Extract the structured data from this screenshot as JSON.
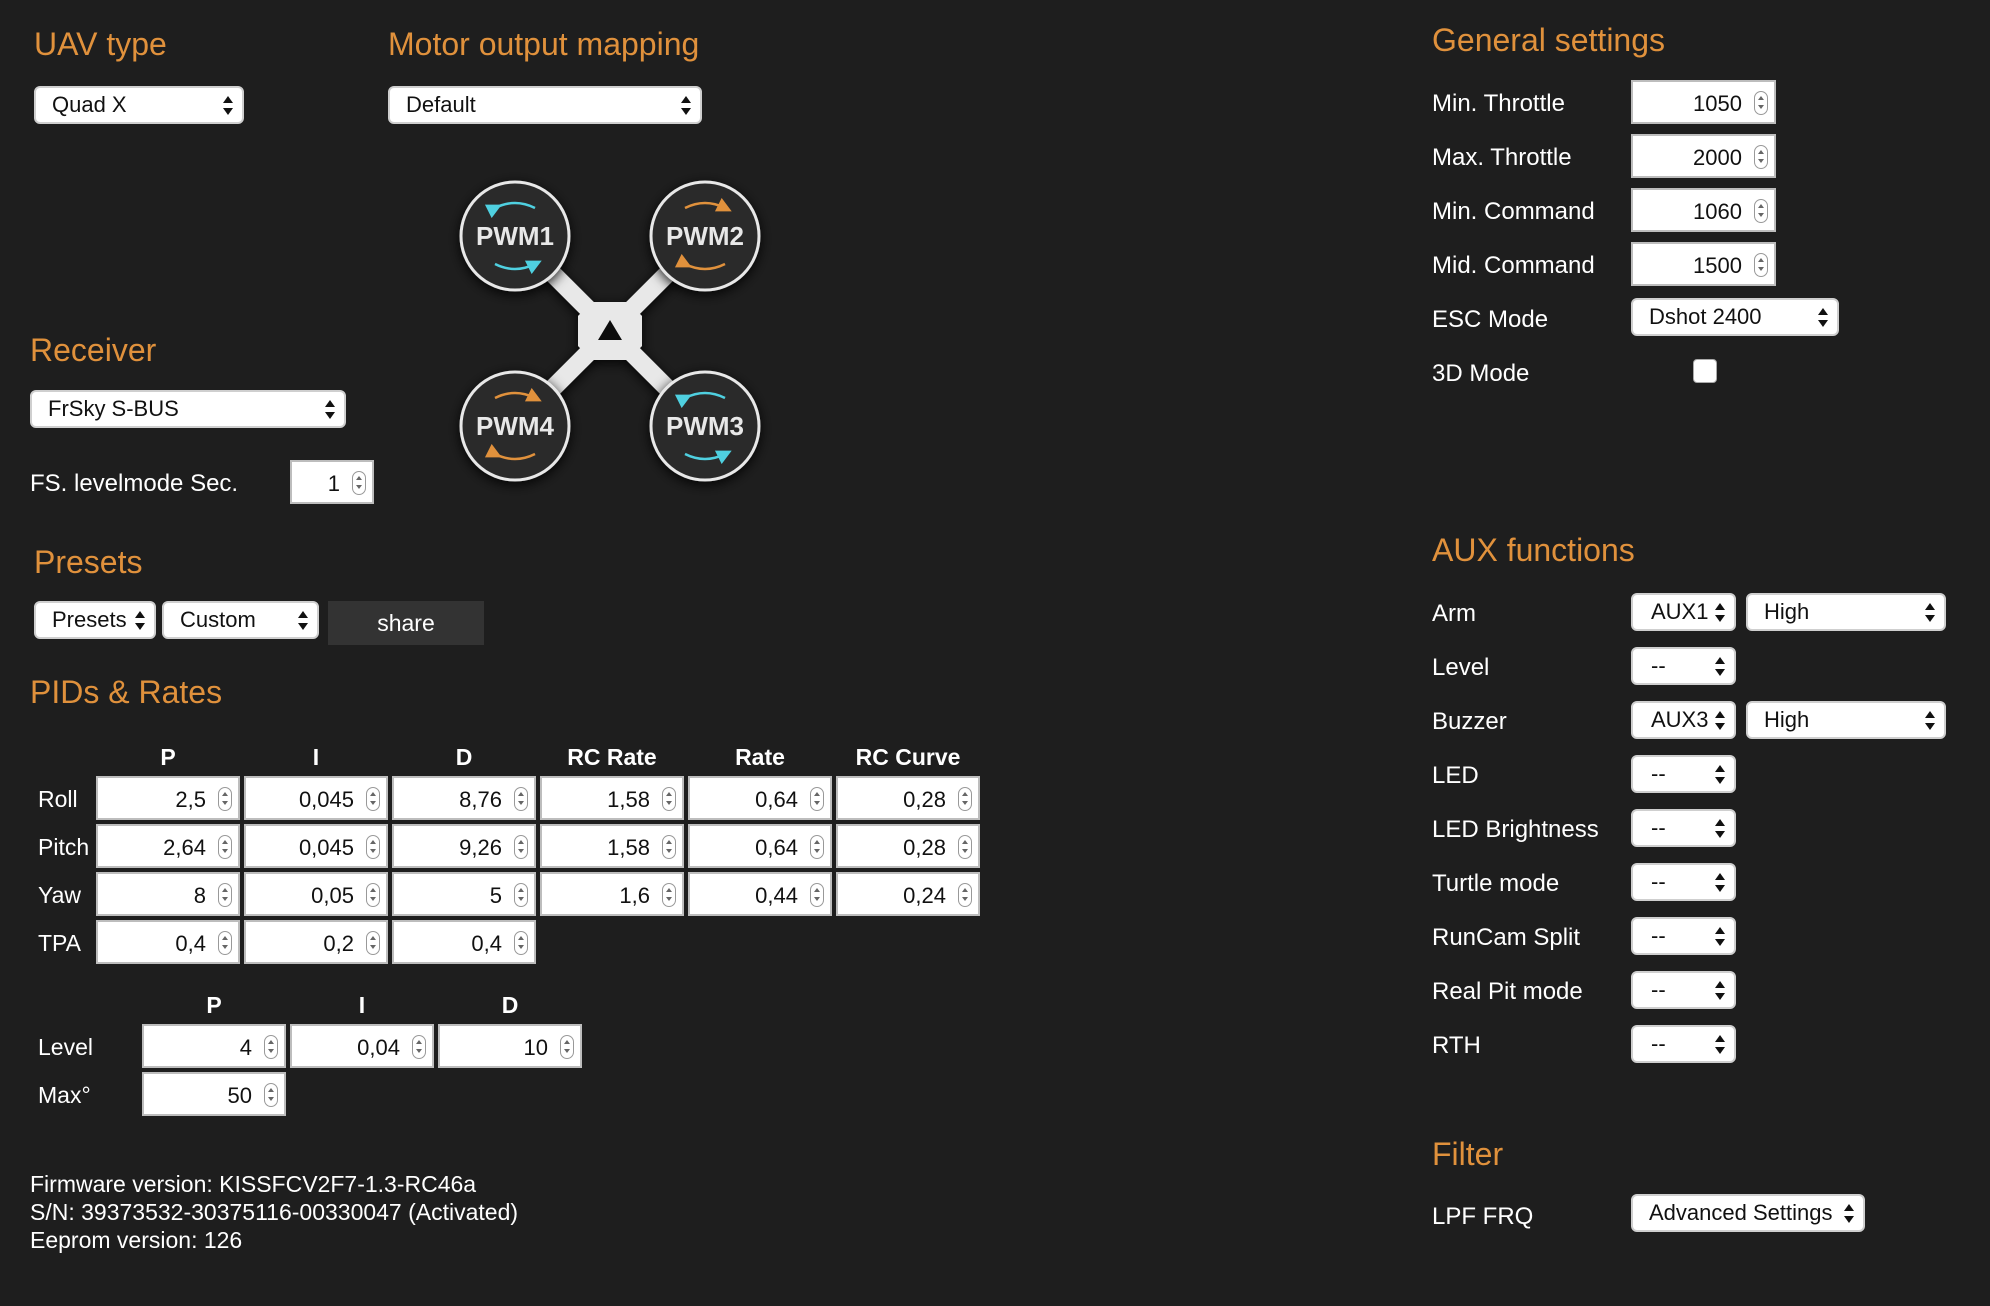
{
  "uav": {
    "title": "UAV type",
    "value": "Quad X"
  },
  "motor": {
    "title": "Motor output mapping",
    "value": "Default",
    "motors": [
      "PWM1",
      "PWM2",
      "PWM3",
      "PWM4"
    ]
  },
  "receiver": {
    "title": "Receiver",
    "value": "FrSky S-BUS",
    "fs_label": "FS. levelmode Sec.",
    "fs_value": "1"
  },
  "presets": {
    "title": "Presets",
    "presets_value": "Presets",
    "custom_value": "Custom",
    "share_label": "share"
  },
  "pids": {
    "title": "PIDs & Rates",
    "headers": [
      "P",
      "I",
      "D",
      "RC Rate",
      "Rate",
      "RC Curve"
    ],
    "rows": [
      {
        "label": "Roll",
        "values": [
          "2,5",
          "0,045",
          "8,76",
          "1,58",
          "0,64",
          "0,28"
        ]
      },
      {
        "label": "Pitch",
        "values": [
          "2,64",
          "0,045",
          "9,26",
          "1,58",
          "0,64",
          "0,28"
        ]
      },
      {
        "label": "Yaw",
        "values": [
          "8",
          "0,05",
          "5",
          "1,6",
          "0,44",
          "0,24"
        ]
      },
      {
        "label": "TPA",
        "values": [
          "0,4",
          "0,2",
          "0,4"
        ]
      }
    ],
    "level_headers": [
      "P",
      "I",
      "D"
    ],
    "level": {
      "label": "Level",
      "values": [
        "4",
        "0,04",
        "10"
      ]
    },
    "max": {
      "label": "Max°",
      "value": "50"
    }
  },
  "firmware": {
    "version": "Firmware version: KISSFCV2F7-1.3-RC46a",
    "serial": "S/N: 39373532-30375116-00330047 (Activated)",
    "eeprom": "Eeprom version: 126"
  },
  "general": {
    "title": "General settings",
    "min_throttle": {
      "label": "Min. Throttle",
      "value": "1050"
    },
    "max_throttle": {
      "label": "Max. Throttle",
      "value": "2000"
    },
    "min_command": {
      "label": "Min. Command",
      "value": "1060"
    },
    "mid_command": {
      "label": "Mid. Command",
      "value": "1500"
    },
    "esc_mode": {
      "label": "ESC Mode",
      "value": "Dshot 2400"
    },
    "mode_3d": {
      "label": "3D Mode",
      "checked": false
    }
  },
  "aux": {
    "title": "AUX functions",
    "items": [
      {
        "label": "Arm",
        "channel": "AUX1",
        "state": "High"
      },
      {
        "label": "Level",
        "channel": "--"
      },
      {
        "label": "Buzzer",
        "channel": "AUX3",
        "state": "High"
      },
      {
        "label": "LED",
        "channel": "--"
      },
      {
        "label": "LED Brightness",
        "channel": "--"
      },
      {
        "label": "Turtle mode",
        "channel": "--"
      },
      {
        "label": "RunCam Split",
        "channel": "--"
      },
      {
        "label": "Real Pit mode",
        "channel": "--"
      },
      {
        "label": "RTH",
        "channel": "--"
      }
    ]
  },
  "filter": {
    "title": "Filter",
    "lpf_label": "LPF FRQ",
    "lpf_value": "Advanced Settings"
  },
  "colors": {
    "background": "#1e1e1e",
    "accent": "#e0913c",
    "cw_arrow": "#e0913c",
    "ccw_arrow": "#4fd0e0"
  }
}
